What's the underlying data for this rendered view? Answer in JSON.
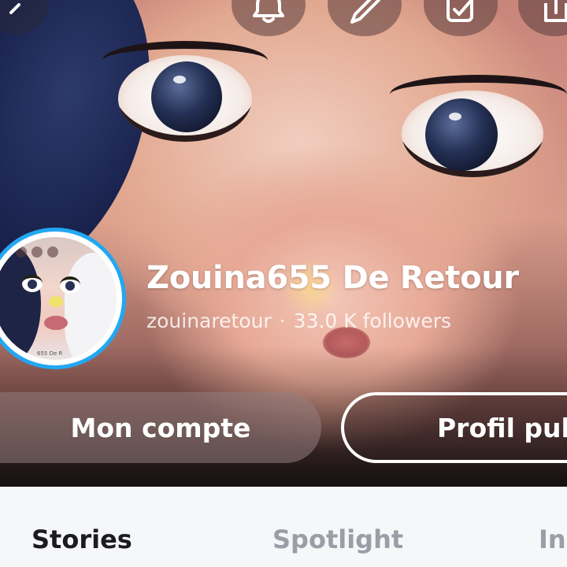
{
  "header": {
    "actions": [
      {
        "icon": "back-icon"
      },
      {
        "icon": "bell-icon"
      },
      {
        "icon": "pencil-icon"
      },
      {
        "icon": "edit-square-icon"
      },
      {
        "icon": "share-icon"
      }
    ]
  },
  "profile": {
    "display_name": "Zouina655 De Retour",
    "username": "zouinaretour",
    "separator": "·",
    "followers": "33.0 K followers",
    "story_ring_color": "#22a7f2",
    "avatar_caption": "655 De R"
  },
  "buttons": {
    "my_account": "Mon compte",
    "public_profile": "Profil public"
  },
  "tabs": [
    {
      "label": "Stories",
      "active": true
    },
    {
      "label": "Spotlight",
      "active": false
    },
    {
      "label": "Insights",
      "active": false
    }
  ]
}
